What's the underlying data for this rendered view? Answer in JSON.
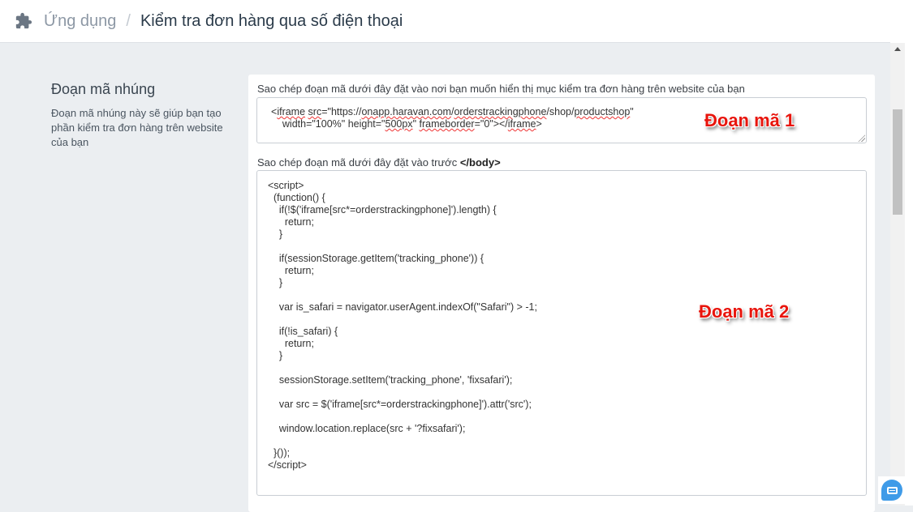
{
  "header": {
    "icon": "puzzle-icon",
    "breadcrumb_parent": "Ứng dụng",
    "separator": "/",
    "title": "Kiểm tra đơn hàng qua số điện thoại"
  },
  "sidebar": {
    "title": "Đoạn mã nhúng",
    "description": "Đoạn mã nhúng này sẽ giúp bạn tạo phần kiểm tra đơn hàng trên website của bạn"
  },
  "snippet1": {
    "label": "Sao chép đoạn mã dưới đây đặt vào nơi bạn muốn hiển thị mục kiểm tra đơn hàng trên website của bạn",
    "lines": [
      "<iframe src=\"https://onapp.haravan.com/orderstrackingphone/shop/productshop\"",
      "    width=\"100%\" height=\"500px\" frameborder=\"0\"></iframe>"
    ],
    "annotation": "Đoạn mã 1"
  },
  "snippet2": {
    "label_prefix": "Sao chép đoạn mã dưới đây đặt vào trước ",
    "label_tag": "</body>",
    "code": "<script>\n  (function() {\n    if(!$('iframe[src*=orderstrackingphone]').length) {\n      return;\n    }\n\n    if(sessionStorage.getItem('tracking_phone')) {\n      return;\n    }\n\n    var is_safari = navigator.userAgent.indexOf(\"Safari\") > -1;\n\n    if(!is_safari) {\n      return;\n    }\n\n    sessionStorage.setItem('tracking_phone', 'fixsafari');\n\n    var src = $('iframe[src*=orderstrackingphone]').attr('src');\n\n    window.location.replace(src + '?fixsafari');\n\n  }());\n</script>",
    "annotation": "Đoạn mã 2"
  },
  "chat": {
    "icon": "chat-icon"
  }
}
